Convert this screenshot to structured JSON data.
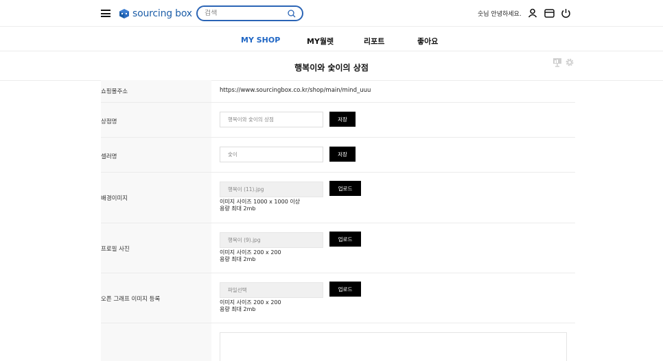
{
  "header": {
    "logo_text": "sourcing box",
    "search": {
      "placeholder": "검색"
    },
    "greeting": "숫님 안녕하세요."
  },
  "nav": {
    "items": [
      {
        "label": "MY SHOP",
        "active": true
      },
      {
        "label": "MY월렛",
        "active": false
      },
      {
        "label": "리포트",
        "active": false
      },
      {
        "label": "좋아요",
        "active": false
      }
    ]
  },
  "page": {
    "title": "행복이와 숯이의 상점"
  },
  "form": {
    "shop_address": {
      "label": "쇼핑몰주소",
      "value": "https://www.sourcingbox.co.kr/shop/main/mind_uuu"
    },
    "shop_name": {
      "label": "상점명",
      "placeholder": "행복이와 숯이의 상점",
      "button": "저장"
    },
    "seller_name": {
      "label": "셀러명",
      "placeholder": "숯이",
      "button": "저장"
    },
    "background_image": {
      "label": "배경이미지",
      "file": "행복이 (11).jpg",
      "button": "업로드",
      "hint_size": "이미지 사이즈 1000 x 1000 이상",
      "hint_capacity": "용량 최대 2mb"
    },
    "profile_photo": {
      "label": "프로필 사진",
      "file": "행복이 (9).jpg",
      "button": "업로드",
      "hint_size": "이미지 사이즈 200 x 200",
      "hint_capacity": "용량 최대 2mb"
    },
    "og_image": {
      "label": "오픈 그래프 이미지 등록",
      "file": "파일선택",
      "button": "업로드",
      "hint_size": "이미지 사이즈 200 x 200",
      "hint_capacity": "용량 최대 2mb"
    }
  },
  "colors": {
    "accent": "#1f66c4",
    "logo": "#1d5ea8",
    "button": "#000000"
  }
}
